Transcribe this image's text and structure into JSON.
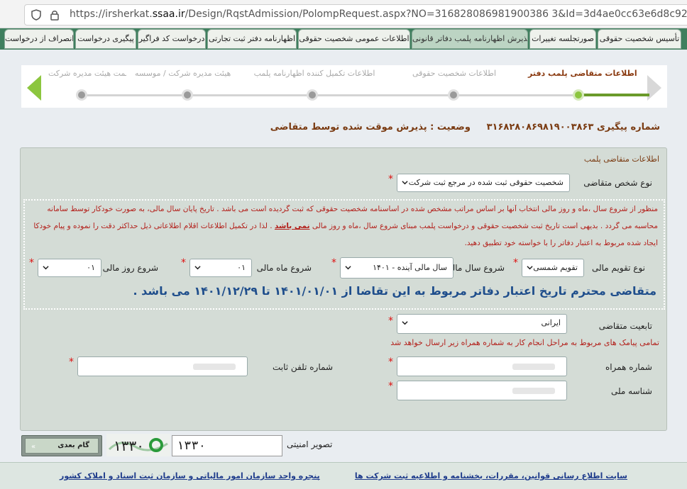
{
  "browser": {
    "url_prefix": "https://irsherkat.",
    "url_domain": "ssaa.ir",
    "url_rest": "/Design/RqstAdmission/PolompRequest.aspx?NO=316828086981900386 3&Id=3d4ae0cc63e6d8c920cc30ba036"
  },
  "tabs": [
    "تأسیس شخصیت حقوقی",
    "صورتجلسه تغییرات",
    "پذیرش اظهارنامه پلمب دفاتر قانونی",
    "اطلاعات عمومی شخصیت حقوقی",
    "اظهارنامه دفتر ثبت تجارتی",
    "درخواست کد فراگیر",
    "پیگیری درخواست",
    "انصراف از درخواست"
  ],
  "wizard": {
    "steps": [
      "اطلاعات متقاضی پلمب دفتر",
      "اطلاعات شخصیت حقوقی",
      "اطلاعات تکمیل کننده اظهارنامه پلمب",
      "هیئت مدیره شرکت / موسسه",
      "سمت هیئت مدیره شرکت"
    ]
  },
  "status": {
    "tracking_label": "شماره پیگیری",
    "tracking_no": "۳۱۶۸۲۸۰۸۶۹۸۱۹۰۰۳۸۶۳",
    "state_label": "وضعیت :",
    "state_value": "پذیرش موقت شده توسط متقاضی"
  },
  "form": {
    "panel_title": "اطلاعات متقاضی پلمب",
    "applicant_type_label": "نوع شخص متقاضی",
    "applicant_type_value": "شخصیت حقوقی ثبت شده در مرجع ثبت شرکت",
    "notice_line1": "منظور از شروع سال ،ماه و روز مالی انتخاب آنها بر اساس مراتب مشخص شده در اساسنامه شخصیت حقوقی که ثبت گردیده است می باشد . تاریخ پایان سال مالی، به صورت خودکار توسط سامانه",
    "notice_line2_a": "محاسبه می گردد . بدیهی است تاریخ ثبت شخصیت حقوقی و درخواست پلمب مبنای شروع سال ،ماه و روز مالی",
    "notice_line2_b": "نمی باشد",
    "notice_line2_c": ". لذا در تکمیل اطلاعات اقلام اطلاعاتی ذیل حداکثر دقت را نموده و پیام خودکار",
    "notice_line3": "ایجاد شده مربوط به اعتبار دفاتر را با خواسته خود تطبیق دهید.",
    "calendar_type_label": "نوع تقویم مالی",
    "calendar_type_value": "تقویم شمسی",
    "fiscal_year_label": "شروع سال مالی",
    "fiscal_year_value": "سال مالی آینده - ۱۴۰۱",
    "fiscal_month_label": "شروع ماه مالی",
    "fiscal_month_value": "۰۱",
    "fiscal_day_label": "شروع روز مالی",
    "fiscal_day_value": "۰۱",
    "validity_note": "متقاضی محترم تاریخ اعتبار دفاتر مربوط به این تقاضا از ۱۴۰۱/۰۱/۰۱ تا ۱۴۰۱/۱۲/۲۹ می باشد .",
    "nationality_label": "تابعیت متقاضی",
    "nationality_value": "ایرانی",
    "sms_note": "تمامی پیامک های مربوط به مراحل انجام کار به شماره همراه زیر ارسال خواهد شد",
    "mobile_label": "شماره همراه",
    "phone_label": "شماره تلفن ثابت",
    "national_id_label": "شناسه ملی",
    "required_mark": "*"
  },
  "captcha": {
    "label": "تصویر امنیتی",
    "value": "۱۳۳۰",
    "image_text": "۱۳۳۰"
  },
  "buttons": {
    "next": "گام بعدی"
  },
  "footer": {
    "link_right": "سایت اطلاع رسانی قوانین، مقررات، بخشنامه و اطلاعیه ثبت شرکت ها",
    "link_left": "پنجره واحد سازمان امور مالیاتی و سازمان ثبت اسناد و املاک کشور"
  },
  "colors": {
    "tab_bar": "#3f7f5e",
    "wizard_active": "#8cc63f",
    "notice_red": "#b3201b",
    "validity_blue": "#1f4e8c",
    "heading_brown": "#7a3b12"
  }
}
